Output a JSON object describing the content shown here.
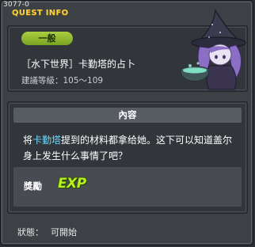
{
  "window": {
    "quest_id": "3077-0",
    "title": "QUEST INFO"
  },
  "quest": {
    "category": "一般",
    "name": "［水下世界］卡勤塔的占卜",
    "level_label": "建議等級：",
    "level_range": "105～109"
  },
  "content": {
    "header": "內容",
    "description_prefix": "将",
    "description_highlight": "卡勤塔",
    "description_suffix": "提到的材料都拿给她。这下可以知道盖尔身上发生什么事情了吧？"
  },
  "reward": {
    "label": "獎勵",
    "exp": "EXP"
  },
  "status": {
    "label": "狀態：",
    "value": "可開始"
  },
  "colors": {
    "title": "#ffd43c",
    "category_pill": "#92bb2f",
    "highlight": "#6fd9ff",
    "exp": "#b6f01f"
  }
}
